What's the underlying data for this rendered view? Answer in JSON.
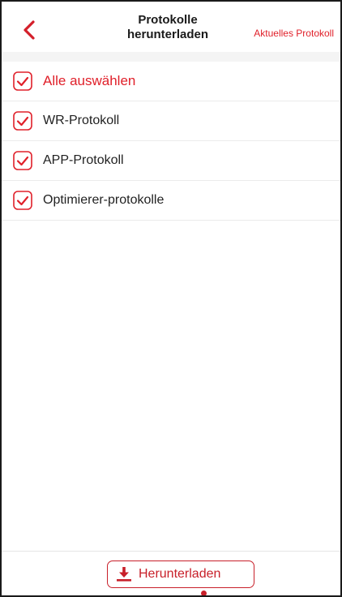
{
  "header": {
    "title_line1": "Protokolle",
    "title_line2": "herunterladen",
    "action_label": "Aktuelles Protokoll",
    "back_icon": "chevron-left-icon"
  },
  "list": {
    "select_all_label": "Alle auswählen",
    "items": [
      {
        "label": "WR-Protokoll",
        "checked": true
      },
      {
        "label": "APP-Protokoll",
        "checked": true
      },
      {
        "label": "Optimierer-protokolle",
        "checked": true
      }
    ],
    "select_all_checked": true
  },
  "footer": {
    "download_label": "Herunterladen",
    "download_icon": "download-icon"
  },
  "colors": {
    "accent": "#e0202a",
    "text": "#222222",
    "divider": "#ebebeb"
  }
}
